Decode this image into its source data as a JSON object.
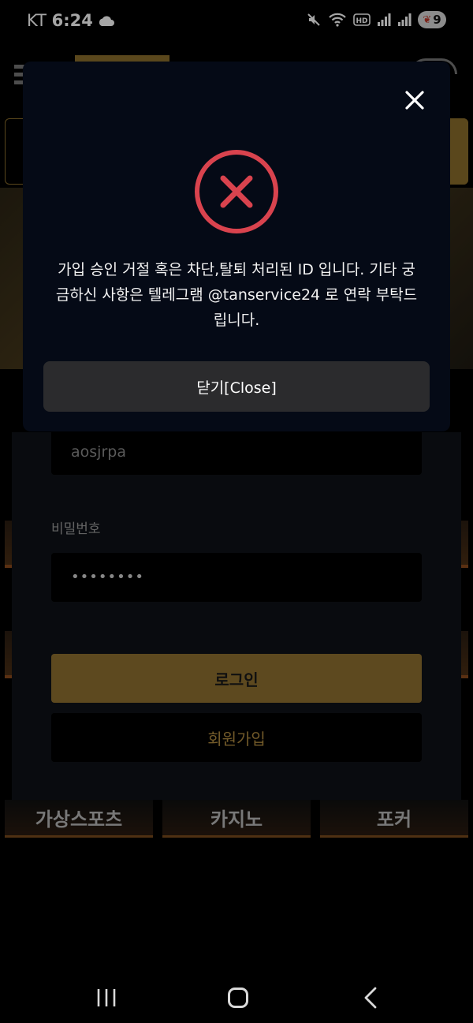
{
  "status_bar": {
    "carrier": "KT",
    "time": "6:24",
    "battery": "9"
  },
  "login_form": {
    "id_value": "aosjrpa",
    "password_label": "비밀번호",
    "password_value": "••••••••",
    "login_button": "로그인",
    "signup_button": "회원가입"
  },
  "game_tiles": [
    "가상스포츠",
    "카지노",
    "포커"
  ],
  "modal": {
    "message": "가입 승인 거절 혹은 차단,탈퇴 처리된 ID 입니다. 기타 궁금하신 사항은 텔레그램 @tanservice24 로 연락 부탁드립니다.",
    "close_button": "닫기[Close]"
  },
  "colors": {
    "accent_gold": "#8f7130",
    "error_red": "#d9434e",
    "modal_bg": "#050a16"
  },
  "icons": {
    "cloud": "cloud-icon",
    "mute": "mute-icon",
    "wifi": "wifi-icon",
    "hd": "hd-icon",
    "signal": "signal-icon",
    "close": "close-icon",
    "error": "error-x-circle-icon"
  }
}
